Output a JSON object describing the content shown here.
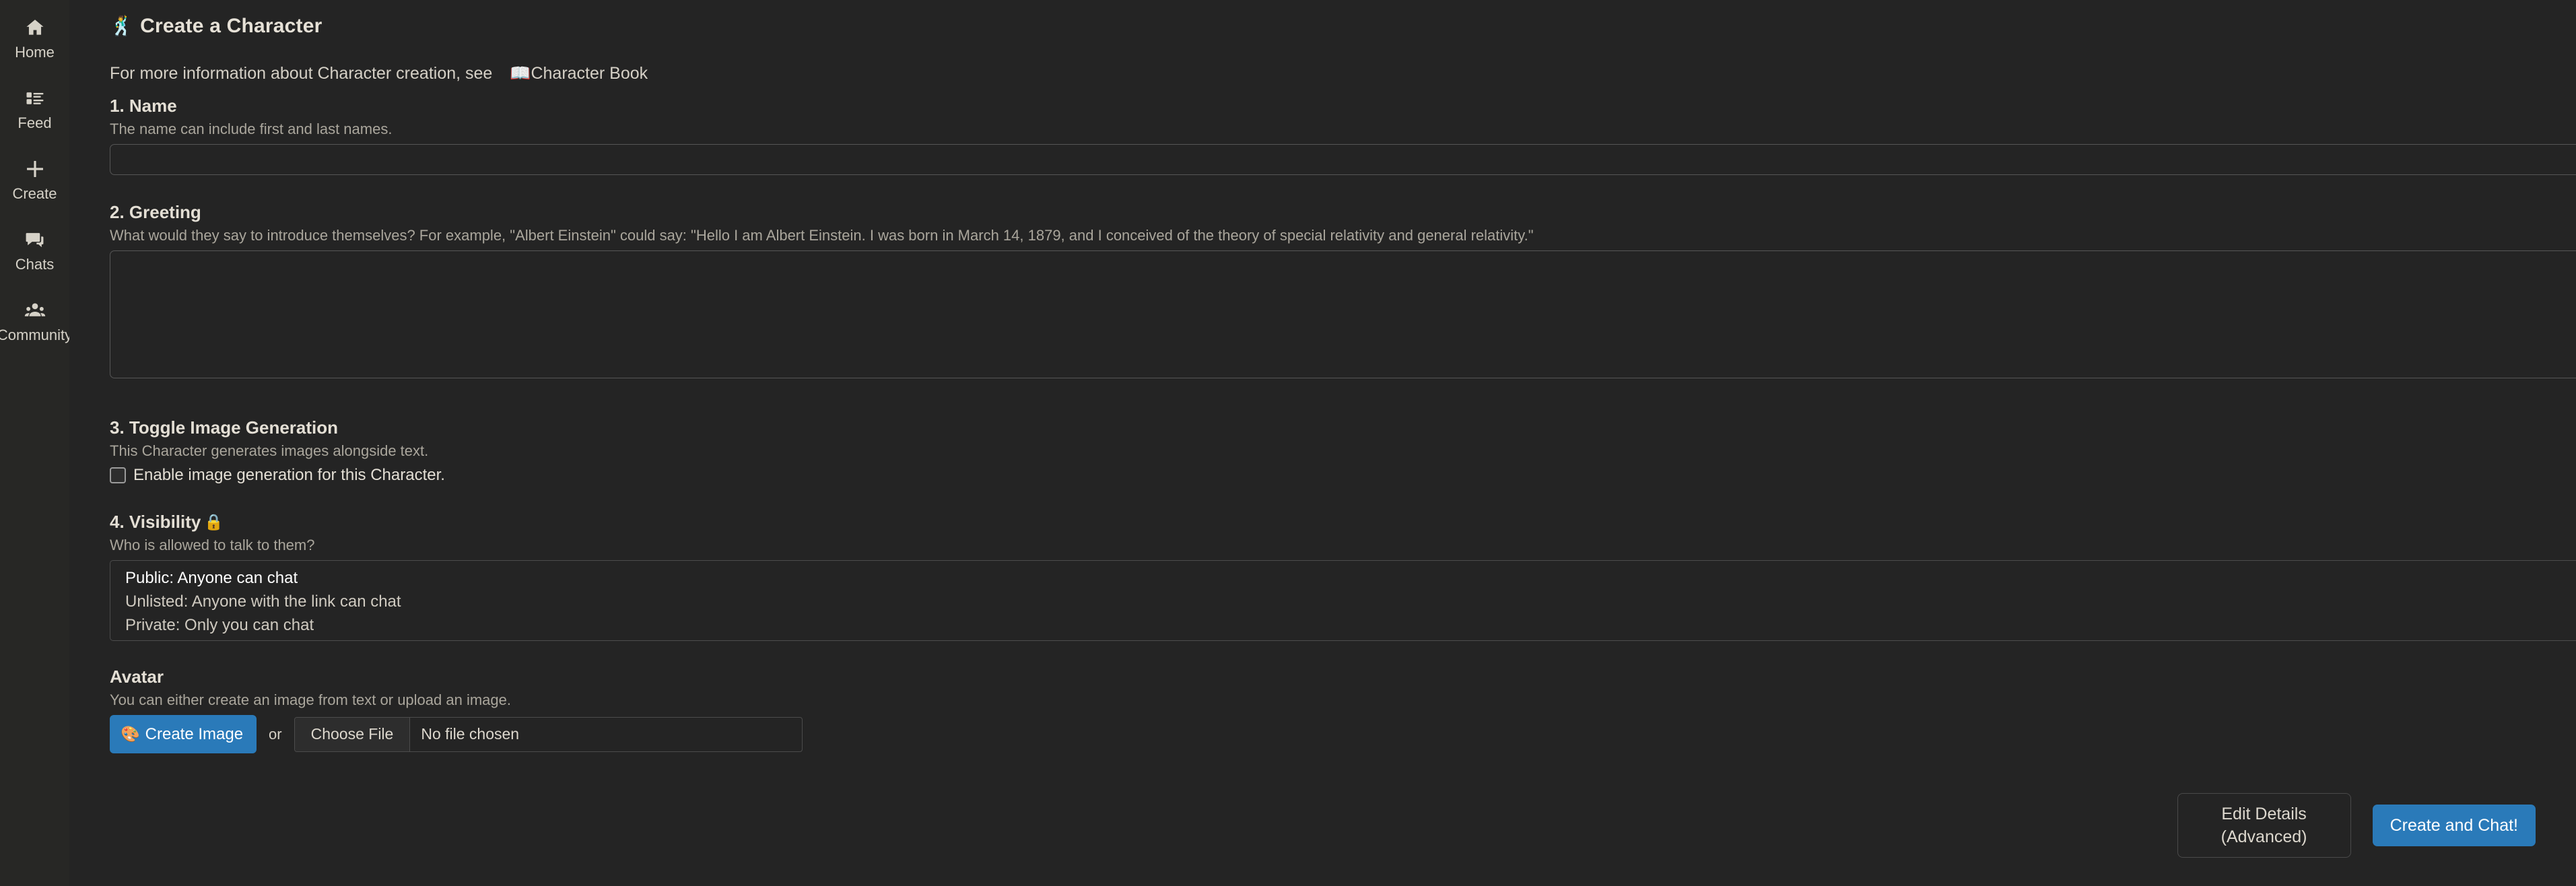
{
  "sidebar": {
    "items": [
      {
        "label": "Home",
        "icon": "home-icon"
      },
      {
        "label": "Feed",
        "icon": "feed-icon"
      },
      {
        "label": "Create",
        "icon": "plus-icon"
      },
      {
        "label": "Chats",
        "icon": "chat-bubble-icon"
      },
      {
        "label": "Community",
        "icon": "people-icon"
      }
    ]
  },
  "header": {
    "title": "Create a Character",
    "title_emoji": "🕺",
    "info_prefix": "For more information about Character creation, see",
    "info_link": "Character Book",
    "info_link_emoji": "📖"
  },
  "name_section": {
    "title": "1. Name",
    "desc": "The name can include first and last names.",
    "value": "",
    "placeholder": ""
  },
  "greeting_section": {
    "title": "2. Greeting",
    "desc": "What would they say to introduce themselves? For example, \"Albert Einstein\" could say: \"Hello I am Albert Einstein. I was born in March 14, 1879, and I conceived of the theory of special relativity and general relativity.\"",
    "value": "",
    "placeholder": ""
  },
  "image_gen_section": {
    "title": "3. Toggle Image Generation",
    "desc": "This Character generates images alongside text.",
    "checkbox_label": "Enable image generation for this Character.",
    "checked": false
  },
  "visibility_section": {
    "title": "4. Visibility",
    "title_emoji": "🔒",
    "desc": "Who is allowed to talk to them?",
    "options": [
      "Public: Anyone can chat",
      "Unlisted: Anyone with the link can chat",
      "Private: Only you can chat"
    ],
    "selected_index": 0
  },
  "avatar_section": {
    "title": "Avatar",
    "desc": "You can either create an image from text or upload an image.",
    "create_image_label": "Create Image",
    "create_image_emoji": "🎨",
    "or_label": "or",
    "choose_file_label": "Choose File",
    "file_status": "No file chosen"
  },
  "footer": {
    "edit_details_line1": "Edit Details",
    "edit_details_line2": "(Advanced)",
    "create_and_chat_label": "Create and Chat!"
  },
  "colors": {
    "background": "#242424",
    "sidebar": "#272725",
    "accent_blue": "#2a7ab9",
    "text_primary": "#e4dfd5",
    "text_muted": "#aaa69c"
  }
}
